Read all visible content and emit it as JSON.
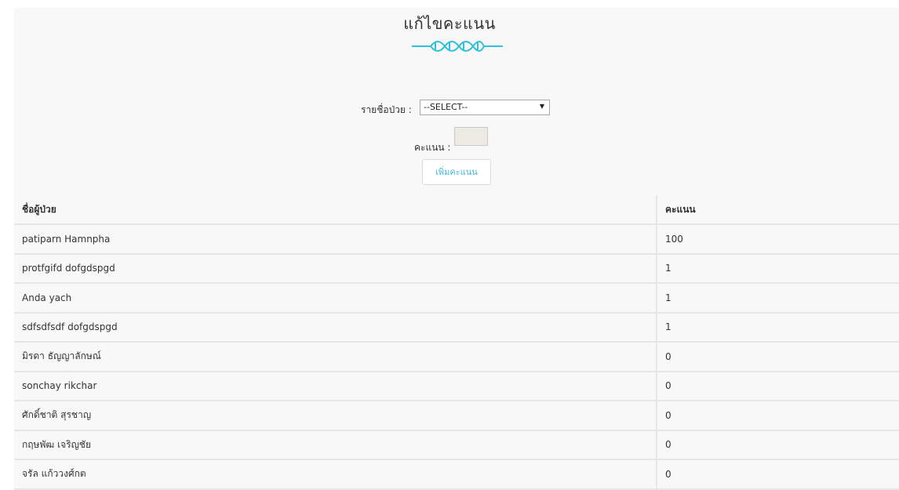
{
  "page": {
    "title": "แก้ไขคะแนน",
    "accent_color": "#32bfd9"
  },
  "form": {
    "patient_label": "รายชื่อป่วย :",
    "patient_select_value": "--SELECT--",
    "score_label": "คะแนน :",
    "score_value": "",
    "add_button": "เพิ่มคะแนน"
  },
  "table": {
    "headers": [
      "ชื่อผู้ป่วย",
      "คะแนน"
    ],
    "rows": [
      {
        "name": "patiparn Hamnpha",
        "score": "100"
      },
      {
        "name": "protfgifd dofgdspgd",
        "score": "1"
      },
      {
        "name": "Anda yach",
        "score": "1"
      },
      {
        "name": "sdfsdfsdf dofgdspgd",
        "score": "1"
      },
      {
        "name": "มิรดา ธัญญาลักษณ์",
        "score": "0"
      },
      {
        "name": "sonchay rikchar",
        "score": "0"
      },
      {
        "name": "ศักดิ์ชาติ สุรชาญ",
        "score": "0"
      },
      {
        "name": "กฤษพัฒ เจริญชัย",
        "score": "0"
      },
      {
        "name": "จรัล แก้ววงศ์กต",
        "score": "0"
      }
    ]
  }
}
